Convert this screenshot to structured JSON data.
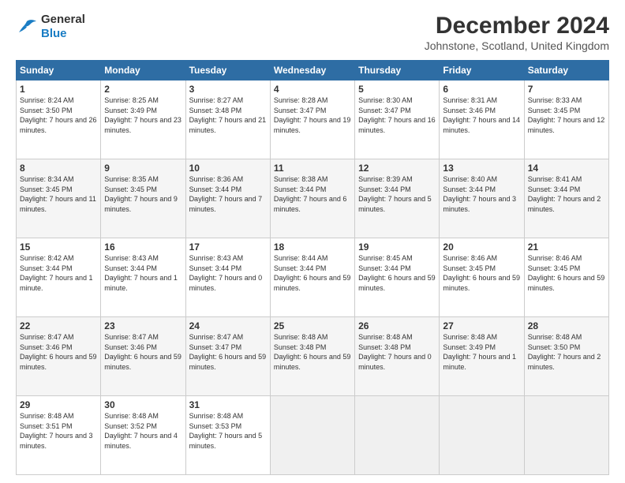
{
  "logo": {
    "text_general": "General",
    "text_blue": "Blue"
  },
  "header": {
    "month": "December 2024",
    "location": "Johnstone, Scotland, United Kingdom"
  },
  "days_of_week": [
    "Sunday",
    "Monday",
    "Tuesday",
    "Wednesday",
    "Thursday",
    "Friday",
    "Saturday"
  ],
  "weeks": [
    [
      {
        "day": 1,
        "rise": "8:24 AM",
        "set": "3:50 PM",
        "daylight": "7 hours and 26 minutes."
      },
      {
        "day": 2,
        "rise": "8:25 AM",
        "set": "3:49 PM",
        "daylight": "7 hours and 23 minutes."
      },
      {
        "day": 3,
        "rise": "8:27 AM",
        "set": "3:48 PM",
        "daylight": "7 hours and 21 minutes."
      },
      {
        "day": 4,
        "rise": "8:28 AM",
        "set": "3:47 PM",
        "daylight": "7 hours and 19 minutes."
      },
      {
        "day": 5,
        "rise": "8:30 AM",
        "set": "3:47 PM",
        "daylight": "7 hours and 16 minutes."
      },
      {
        "day": 6,
        "rise": "8:31 AM",
        "set": "3:46 PM",
        "daylight": "7 hours and 14 minutes."
      },
      {
        "day": 7,
        "rise": "8:33 AM",
        "set": "3:45 PM",
        "daylight": "7 hours and 12 minutes."
      }
    ],
    [
      {
        "day": 8,
        "rise": "8:34 AM",
        "set": "3:45 PM",
        "daylight": "7 hours and 11 minutes."
      },
      {
        "day": 9,
        "rise": "8:35 AM",
        "set": "3:45 PM",
        "daylight": "7 hours and 9 minutes."
      },
      {
        "day": 10,
        "rise": "8:36 AM",
        "set": "3:44 PM",
        "daylight": "7 hours and 7 minutes."
      },
      {
        "day": 11,
        "rise": "8:38 AM",
        "set": "3:44 PM",
        "daylight": "7 hours and 6 minutes."
      },
      {
        "day": 12,
        "rise": "8:39 AM",
        "set": "3:44 PM",
        "daylight": "7 hours and 5 minutes."
      },
      {
        "day": 13,
        "rise": "8:40 AM",
        "set": "3:44 PM",
        "daylight": "7 hours and 3 minutes."
      },
      {
        "day": 14,
        "rise": "8:41 AM",
        "set": "3:44 PM",
        "daylight": "7 hours and 2 minutes."
      }
    ],
    [
      {
        "day": 15,
        "rise": "8:42 AM",
        "set": "3:44 PM",
        "daylight": "7 hours and 1 minute."
      },
      {
        "day": 16,
        "rise": "8:43 AM",
        "set": "3:44 PM",
        "daylight": "7 hours and 1 minute."
      },
      {
        "day": 17,
        "rise": "8:43 AM",
        "set": "3:44 PM",
        "daylight": "7 hours and 0 minutes."
      },
      {
        "day": 18,
        "rise": "8:44 AM",
        "set": "3:44 PM",
        "daylight": "6 hours and 59 minutes."
      },
      {
        "day": 19,
        "rise": "8:45 AM",
        "set": "3:44 PM",
        "daylight": "6 hours and 59 minutes."
      },
      {
        "day": 20,
        "rise": "8:46 AM",
        "set": "3:45 PM",
        "daylight": "6 hours and 59 minutes."
      },
      {
        "day": 21,
        "rise": "8:46 AM",
        "set": "3:45 PM",
        "daylight": "6 hours and 59 minutes."
      }
    ],
    [
      {
        "day": 22,
        "rise": "8:47 AM",
        "set": "3:46 PM",
        "daylight": "6 hours and 59 minutes."
      },
      {
        "day": 23,
        "rise": "8:47 AM",
        "set": "3:46 PM",
        "daylight": "6 hours and 59 minutes."
      },
      {
        "day": 24,
        "rise": "8:47 AM",
        "set": "3:47 PM",
        "daylight": "6 hours and 59 minutes."
      },
      {
        "day": 25,
        "rise": "8:48 AM",
        "set": "3:48 PM",
        "daylight": "6 hours and 59 minutes."
      },
      {
        "day": 26,
        "rise": "8:48 AM",
        "set": "3:48 PM",
        "daylight": "7 hours and 0 minutes."
      },
      {
        "day": 27,
        "rise": "8:48 AM",
        "set": "3:49 PM",
        "daylight": "7 hours and 1 minute."
      },
      {
        "day": 28,
        "rise": "8:48 AM",
        "set": "3:50 PM",
        "daylight": "7 hours and 2 minutes."
      }
    ],
    [
      {
        "day": 29,
        "rise": "8:48 AM",
        "set": "3:51 PM",
        "daylight": "7 hours and 3 minutes."
      },
      {
        "day": 30,
        "rise": "8:48 AM",
        "set": "3:52 PM",
        "daylight": "7 hours and 4 minutes."
      },
      {
        "day": 31,
        "rise": "8:48 AM",
        "set": "3:53 PM",
        "daylight": "7 hours and 5 minutes."
      },
      null,
      null,
      null,
      null
    ]
  ]
}
